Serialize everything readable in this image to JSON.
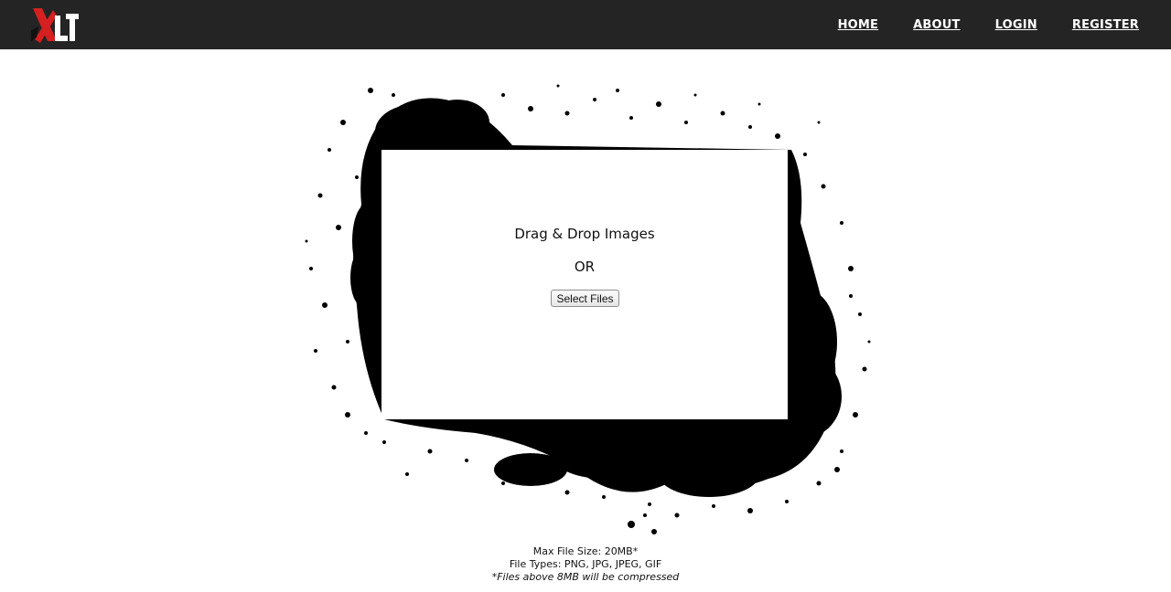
{
  "header": {
    "logo_text": "XL",
    "nav": [
      {
        "label": "HOME"
      },
      {
        "label": "ABOUT"
      },
      {
        "label": "LOGIN"
      },
      {
        "label": "REGISTER"
      }
    ]
  },
  "upload": {
    "title": "Drag & Drop Images",
    "or": "OR",
    "button_label": "Select Files"
  },
  "info": {
    "max_size": "Max File Size: 20MB*",
    "file_types": "File Types: PNG, JPG, JPEG, GIF",
    "note": "*Files above 8MB will be compressed"
  },
  "colors": {
    "navbar": "#242424",
    "logo_accent": "#d42020",
    "splatter": "#000000"
  }
}
